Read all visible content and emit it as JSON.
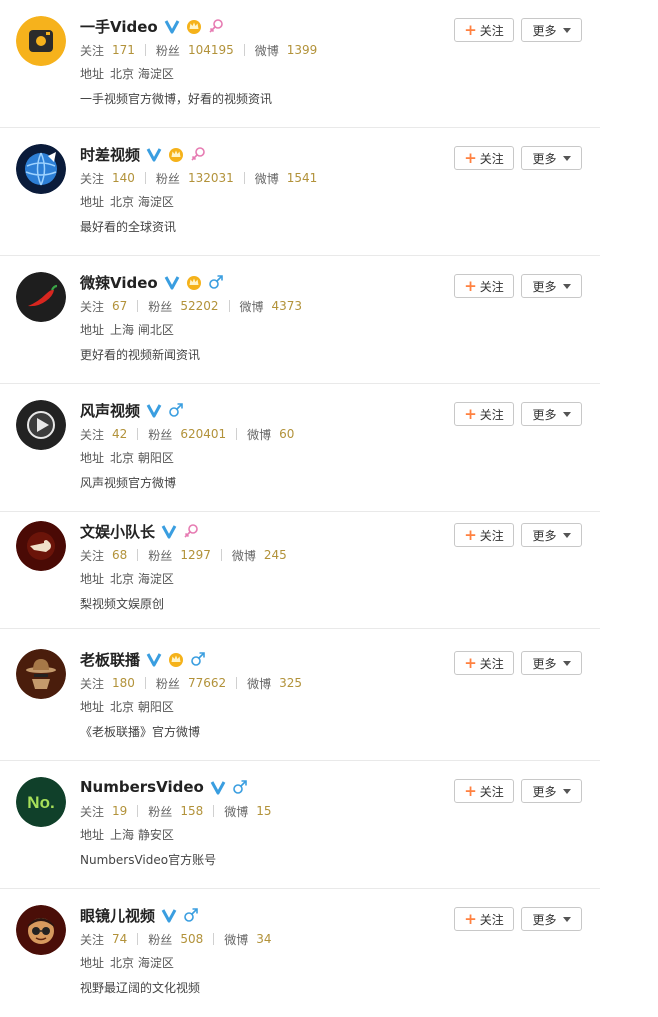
{
  "labels": {
    "follow": "关注",
    "fans": "粉丝",
    "weibo": "微博",
    "address": "地址",
    "follow_btn": "关注",
    "more_btn": "更多"
  },
  "colors": {
    "stat_number": "#b2923a",
    "verified_blue": "#3a9ee0",
    "female_pink": "#e67bb2",
    "male_blue": "#3a9ee0",
    "crown_gold": "#f5b21a",
    "plus_orange": "#ff8140"
  },
  "users": [
    {
      "name": "一手Video",
      "verified": true,
      "crown": true,
      "gender": "female",
      "following": "171",
      "fans": "104195",
      "weibo": "1399",
      "location": "北京 海淀区",
      "bio": "一手视频官方微博，好看的视频资讯",
      "avatar_icon": "yishou-logo-icon"
    },
    {
      "name": "时差视频",
      "verified": true,
      "crown": true,
      "gender": "female",
      "following": "140",
      "fans": "132031",
      "weibo": "1541",
      "location": "北京 海淀区",
      "bio": "最好看的全球资讯",
      "avatar_icon": "globe-logo-icon"
    },
    {
      "name": "微辣Video",
      "verified": true,
      "crown": true,
      "gender": "male",
      "following": "67",
      "fans": "52202",
      "weibo": "4373",
      "location": "上海 闸北区",
      "bio": "更好看的视频新闻资讯",
      "avatar_icon": "chili-logo-icon"
    },
    {
      "name": "风声视频",
      "verified": true,
      "crown": false,
      "gender": "male",
      "following": "42",
      "fans": "620401",
      "weibo": "60",
      "location": "北京 朝阳区",
      "bio": "风声视频官方微博",
      "avatar_icon": "play-logo-icon"
    },
    {
      "name": "文娱小队长",
      "verified": true,
      "crown": false,
      "gender": "female",
      "following": "68",
      "fans": "1297",
      "weibo": "245",
      "location": "北京 海淀区",
      "bio": "梨视频文娱原创",
      "avatar_icon": "pointing-hand-logo-icon"
    },
    {
      "name": "老板联播",
      "verified": true,
      "crown": true,
      "gender": "male",
      "following": "180",
      "fans": "77662",
      "weibo": "325",
      "location": "北京 朝阳区",
      "bio": "《老板联播》官方微博",
      "avatar_icon": "boss-hat-logo-icon"
    },
    {
      "name": "NumbersVideo",
      "verified": true,
      "crown": false,
      "gender": "male",
      "following": "19",
      "fans": "158",
      "weibo": "15",
      "location": "上海 静安区",
      "bio": "NumbersVideo官方账号",
      "avatar_icon": "no-logo-icon"
    },
    {
      "name": "眼镜儿视频",
      "verified": true,
      "crown": false,
      "gender": "male",
      "following": "74",
      "fans": "508",
      "weibo": "34",
      "location": "北京 海淀区",
      "bio": "视野最辽阔的文化视频",
      "avatar_icon": "glasses-face-logo-icon"
    }
  ]
}
